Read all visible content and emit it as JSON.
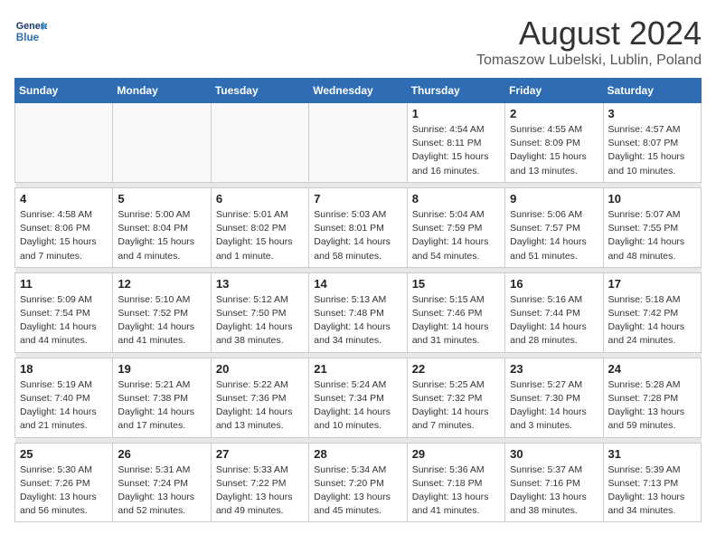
{
  "header": {
    "logo_line1": "General",
    "logo_line2": "Blue",
    "month": "August 2024",
    "location": "Tomaszow Lubelski, Lublin, Poland"
  },
  "days_of_week": [
    "Sunday",
    "Monday",
    "Tuesday",
    "Wednesday",
    "Thursday",
    "Friday",
    "Saturday"
  ],
  "weeks": [
    [
      {
        "day": "",
        "info": ""
      },
      {
        "day": "",
        "info": ""
      },
      {
        "day": "",
        "info": ""
      },
      {
        "day": "",
        "info": ""
      },
      {
        "day": "1",
        "info": "Sunrise: 4:54 AM\nSunset: 8:11 PM\nDaylight: 15 hours\nand 16 minutes."
      },
      {
        "day": "2",
        "info": "Sunrise: 4:55 AM\nSunset: 8:09 PM\nDaylight: 15 hours\nand 13 minutes."
      },
      {
        "day": "3",
        "info": "Sunrise: 4:57 AM\nSunset: 8:07 PM\nDaylight: 15 hours\nand 10 minutes."
      }
    ],
    [
      {
        "day": "4",
        "info": "Sunrise: 4:58 AM\nSunset: 8:06 PM\nDaylight: 15 hours\nand 7 minutes."
      },
      {
        "day": "5",
        "info": "Sunrise: 5:00 AM\nSunset: 8:04 PM\nDaylight: 15 hours\nand 4 minutes."
      },
      {
        "day": "6",
        "info": "Sunrise: 5:01 AM\nSunset: 8:02 PM\nDaylight: 15 hours\nand 1 minute."
      },
      {
        "day": "7",
        "info": "Sunrise: 5:03 AM\nSunset: 8:01 PM\nDaylight: 14 hours\nand 58 minutes."
      },
      {
        "day": "8",
        "info": "Sunrise: 5:04 AM\nSunset: 7:59 PM\nDaylight: 14 hours\nand 54 minutes."
      },
      {
        "day": "9",
        "info": "Sunrise: 5:06 AM\nSunset: 7:57 PM\nDaylight: 14 hours\nand 51 minutes."
      },
      {
        "day": "10",
        "info": "Sunrise: 5:07 AM\nSunset: 7:55 PM\nDaylight: 14 hours\nand 48 minutes."
      }
    ],
    [
      {
        "day": "11",
        "info": "Sunrise: 5:09 AM\nSunset: 7:54 PM\nDaylight: 14 hours\nand 44 minutes."
      },
      {
        "day": "12",
        "info": "Sunrise: 5:10 AM\nSunset: 7:52 PM\nDaylight: 14 hours\nand 41 minutes."
      },
      {
        "day": "13",
        "info": "Sunrise: 5:12 AM\nSunset: 7:50 PM\nDaylight: 14 hours\nand 38 minutes."
      },
      {
        "day": "14",
        "info": "Sunrise: 5:13 AM\nSunset: 7:48 PM\nDaylight: 14 hours\nand 34 minutes."
      },
      {
        "day": "15",
        "info": "Sunrise: 5:15 AM\nSunset: 7:46 PM\nDaylight: 14 hours\nand 31 minutes."
      },
      {
        "day": "16",
        "info": "Sunrise: 5:16 AM\nSunset: 7:44 PM\nDaylight: 14 hours\nand 28 minutes."
      },
      {
        "day": "17",
        "info": "Sunrise: 5:18 AM\nSunset: 7:42 PM\nDaylight: 14 hours\nand 24 minutes."
      }
    ],
    [
      {
        "day": "18",
        "info": "Sunrise: 5:19 AM\nSunset: 7:40 PM\nDaylight: 14 hours\nand 21 minutes."
      },
      {
        "day": "19",
        "info": "Sunrise: 5:21 AM\nSunset: 7:38 PM\nDaylight: 14 hours\nand 17 minutes."
      },
      {
        "day": "20",
        "info": "Sunrise: 5:22 AM\nSunset: 7:36 PM\nDaylight: 14 hours\nand 13 minutes."
      },
      {
        "day": "21",
        "info": "Sunrise: 5:24 AM\nSunset: 7:34 PM\nDaylight: 14 hours\nand 10 minutes."
      },
      {
        "day": "22",
        "info": "Sunrise: 5:25 AM\nSunset: 7:32 PM\nDaylight: 14 hours\nand 7 minutes."
      },
      {
        "day": "23",
        "info": "Sunrise: 5:27 AM\nSunset: 7:30 PM\nDaylight: 14 hours\nand 3 minutes."
      },
      {
        "day": "24",
        "info": "Sunrise: 5:28 AM\nSunset: 7:28 PM\nDaylight: 13 hours\nand 59 minutes."
      }
    ],
    [
      {
        "day": "25",
        "info": "Sunrise: 5:30 AM\nSunset: 7:26 PM\nDaylight: 13 hours\nand 56 minutes."
      },
      {
        "day": "26",
        "info": "Sunrise: 5:31 AM\nSunset: 7:24 PM\nDaylight: 13 hours\nand 52 minutes."
      },
      {
        "day": "27",
        "info": "Sunrise: 5:33 AM\nSunset: 7:22 PM\nDaylight: 13 hours\nand 49 minutes."
      },
      {
        "day": "28",
        "info": "Sunrise: 5:34 AM\nSunset: 7:20 PM\nDaylight: 13 hours\nand 45 minutes."
      },
      {
        "day": "29",
        "info": "Sunrise: 5:36 AM\nSunset: 7:18 PM\nDaylight: 13 hours\nand 41 minutes."
      },
      {
        "day": "30",
        "info": "Sunrise: 5:37 AM\nSunset: 7:16 PM\nDaylight: 13 hours\nand 38 minutes."
      },
      {
        "day": "31",
        "info": "Sunrise: 5:39 AM\nSunset: 7:13 PM\nDaylight: 13 hours\nand 34 minutes."
      }
    ]
  ]
}
